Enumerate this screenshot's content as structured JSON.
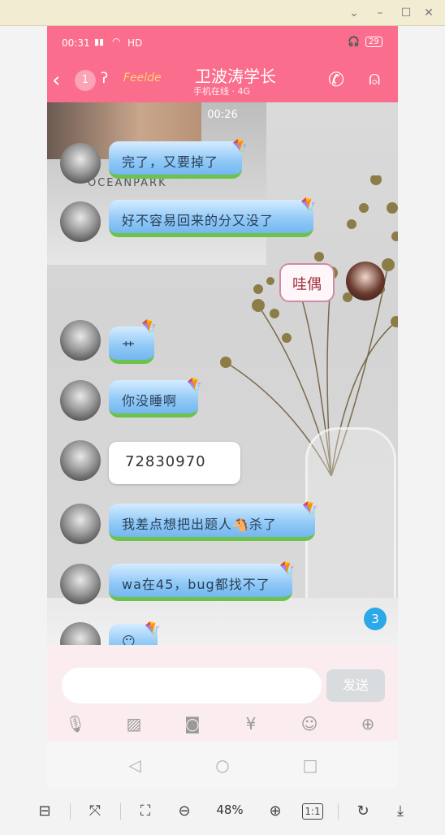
{
  "status": {
    "time": "00:31",
    "signal": "HD",
    "battery": "29"
  },
  "header": {
    "unread": "1",
    "title": "卫波涛学长",
    "subtitle": "手机在线 · 4G",
    "logo_text": "Feelde"
  },
  "chat": {
    "timestamp": "00:26",
    "messages": [
      {
        "text": "完了，又要掉了"
      },
      {
        "text": "好不容易回来的分又没了"
      },
      {
        "text": "哇偶"
      },
      {
        "text": "艹"
      },
      {
        "text": "你没睡啊"
      },
      {
        "text": "72830970"
      },
      {
        "text": "我差点想把出题人🐴杀了"
      },
      {
        "text": "wa在45，bug都找不了"
      },
      {
        "text": "😶"
      }
    ],
    "new_badge": "3"
  },
  "wallpaper": {
    "poster_text": "OCEANPARK"
  },
  "input": {
    "placeholder": "",
    "send_label": "发送"
  },
  "toolbar": {
    "zoom": "48%",
    "actual_size_label": "1:1"
  },
  "colors": {
    "header": "#fb6d8c",
    "input_bg": "#fbecef",
    "badge": "#2aa8e8"
  }
}
